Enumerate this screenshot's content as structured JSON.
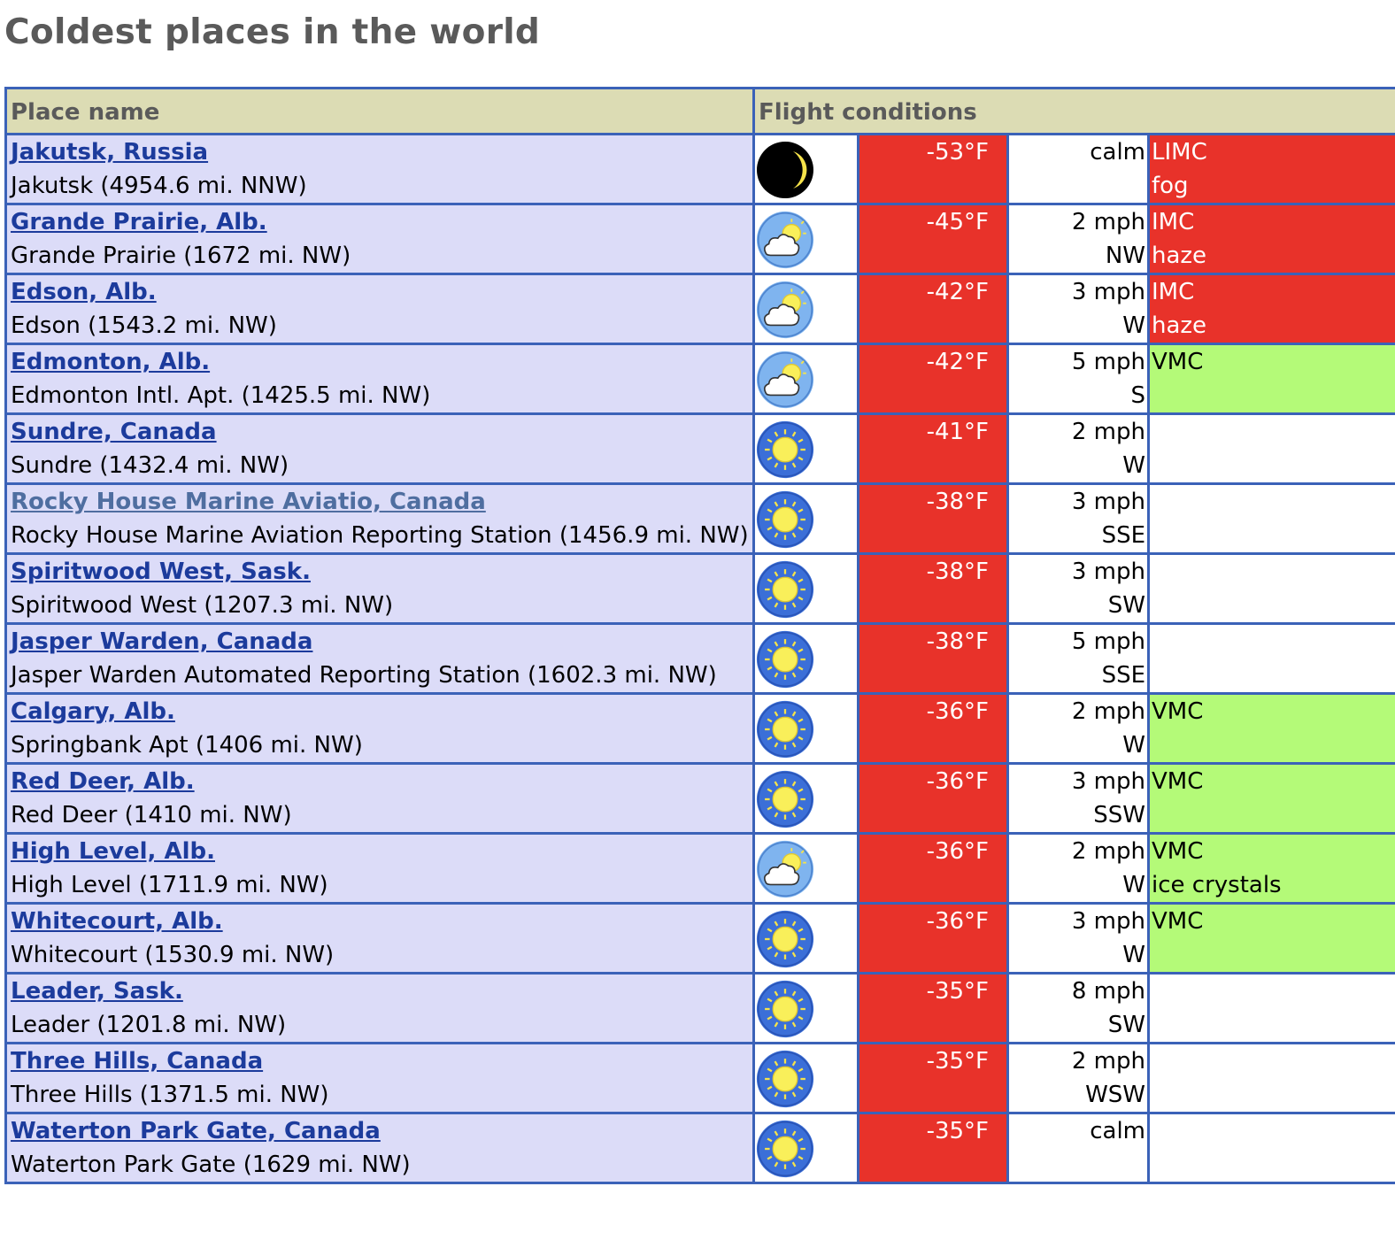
{
  "page": {
    "title": "Coldest places in the world"
  },
  "table": {
    "headers": {
      "place": "Place name",
      "flight": "Flight conditions"
    },
    "rows": [
      {
        "link": "Jakutsk, Russia",
        "station": "Jakutsk (4954.6 mi. NNW)",
        "icon": "moon-icon",
        "temp": "-53°F",
        "wind_speed": "calm",
        "wind_dir": "",
        "cond": "LIMC",
        "cond2": "fog",
        "cond_color": "red"
      },
      {
        "link": "Grande Prairie, Alb.",
        "station": "Grande Prairie (1672 mi. NW)",
        "icon": "sun-cloud-icon",
        "temp": "-45°F",
        "wind_speed": "2 mph",
        "wind_dir": "NW",
        "cond": "IMC",
        "cond2": "haze",
        "cond_color": "red"
      },
      {
        "link": "Edson, Alb.",
        "station": "Edson (1543.2 mi. NW)",
        "icon": "sun-cloud-icon",
        "temp": "-42°F",
        "wind_speed": "3 mph",
        "wind_dir": "W",
        "cond": "IMC",
        "cond2": "haze",
        "cond_color": "red"
      },
      {
        "link": "Edmonton, Alb.",
        "station": "Edmonton Intl. Apt. (1425.5 mi. NW)",
        "icon": "sun-cloud-icon",
        "temp": "-42°F",
        "wind_speed": "5 mph",
        "wind_dir": "S",
        "cond": "VMC",
        "cond2": "",
        "cond_color": "green"
      },
      {
        "link": "Sundre, Canada",
        "station": "Sundre (1432.4 mi. NW)",
        "icon": "sun-icon",
        "temp": "-41°F",
        "wind_speed": "2 mph",
        "wind_dir": "W",
        "cond": "",
        "cond2": "",
        "cond_color": "none"
      },
      {
        "link": "Rocky House Marine Aviatio, Canada",
        "station": "Rocky House Marine Aviation Reporting Station (1456.9 mi. NW)",
        "icon": "sun-icon",
        "temp": "-38°F",
        "wind_speed": "3 mph",
        "wind_dir": "SSE",
        "cond": "",
        "cond2": "",
        "cond_color": "none",
        "visited": true
      },
      {
        "link": "Spiritwood West, Sask.",
        "station": "Spiritwood West (1207.3 mi. NW)",
        "icon": "sun-icon",
        "temp": "-38°F",
        "wind_speed": "3 mph",
        "wind_dir": "SW",
        "cond": "",
        "cond2": "",
        "cond_color": "none"
      },
      {
        "link": "Jasper Warden, Canada",
        "station": "Jasper Warden Automated Reporting Station (1602.3 mi. NW)",
        "icon": "sun-icon",
        "temp": "-38°F",
        "wind_speed": "5 mph",
        "wind_dir": "SSE",
        "cond": "",
        "cond2": "",
        "cond_color": "none"
      },
      {
        "link": "Calgary, Alb.",
        "station": "Springbank Apt (1406 mi. NW)",
        "icon": "sun-icon",
        "temp": "-36°F",
        "wind_speed": "2 mph",
        "wind_dir": "W",
        "cond": "VMC",
        "cond2": "",
        "cond_color": "green"
      },
      {
        "link": "Red Deer, Alb.",
        "station": "Red Deer (1410 mi. NW)",
        "icon": "sun-icon",
        "temp": "-36°F",
        "wind_speed": "3 mph",
        "wind_dir": "SSW",
        "cond": "VMC",
        "cond2": "",
        "cond_color": "green"
      },
      {
        "link": "High Level, Alb.",
        "station": "High Level (1711.9 mi. NW)",
        "icon": "sun-cloud-icon",
        "temp": "-36°F",
        "wind_speed": "2 mph",
        "wind_dir": "W",
        "cond": "VMC",
        "cond2": "ice crystals",
        "cond_color": "green"
      },
      {
        "link": "Whitecourt, Alb.",
        "station": "Whitecourt (1530.9 mi. NW)",
        "icon": "sun-icon",
        "temp": "-36°F",
        "wind_speed": "3 mph",
        "wind_dir": "W",
        "cond": "VMC",
        "cond2": "",
        "cond_color": "green"
      },
      {
        "link": "Leader, Sask.",
        "station": "Leader (1201.8 mi. NW)",
        "icon": "sun-icon",
        "temp": "-35°F",
        "wind_speed": "8 mph",
        "wind_dir": "SW",
        "cond": "",
        "cond2": "",
        "cond_color": "none"
      },
      {
        "link": "Three Hills, Canada",
        "station": "Three Hills (1371.5 mi. NW)",
        "icon": "sun-icon",
        "temp": "-35°F",
        "wind_speed": "2 mph",
        "wind_dir": "WSW",
        "cond": "",
        "cond2": "",
        "cond_color": "none"
      },
      {
        "link": "Waterton Park Gate, Canada",
        "station": "Waterton Park Gate (1629 mi. NW)",
        "icon": "sun-icon",
        "temp": "-35°F",
        "wind_speed": "calm",
        "wind_dir": "",
        "cond": "",
        "cond2": "",
        "cond_color": "none"
      }
    ]
  }
}
